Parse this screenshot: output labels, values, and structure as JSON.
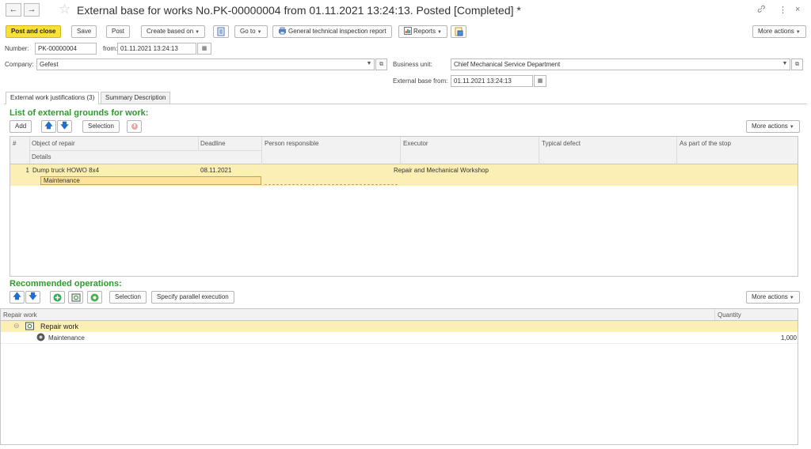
{
  "window": {
    "title": "External base for works No.PK-00000004 from 01.11.2021 13:24:13. Posted [Completed] *",
    "back": "←",
    "forward": "→",
    "star": "☆",
    "link_icon": "🔗",
    "menu_icon": "⋮",
    "close_icon": "×"
  },
  "toolbar": {
    "post_and_close": "Post and close",
    "save": "Save",
    "post": "Post",
    "create_based_on": "Create based on",
    "go_to": "Go to",
    "general_report": "General technical inspection report",
    "reports": "Reports",
    "more_actions": "More actions"
  },
  "form": {
    "number_label": "Number:",
    "number_value": "PK-00000004",
    "from_label": "from:",
    "from_value": "01.11.2021 13:24:13",
    "company_label": "Company:",
    "company_value": "Gefest",
    "business_unit_label": "Business unit:",
    "business_unit_value": "Chief Mechanical Service Department",
    "external_base_label": "External base from:",
    "external_base_value": "01.11.2021 13:24:13"
  },
  "tabs": [
    {
      "label": "External work justifications (3)"
    },
    {
      "label": "Summary Description"
    }
  ],
  "grounds": {
    "title": "List of external grounds for work:",
    "add": "Add",
    "selection": "Selection",
    "more_actions": "More actions",
    "columns": {
      "num": "#",
      "object": "Object of repair",
      "details": "Details",
      "deadline": "Deadline",
      "person": "Person responsible",
      "executor": "Executor",
      "defect": "Typical defect",
      "stop": "As part of the stop"
    },
    "rows": [
      {
        "num": "1",
        "object": "Dump truck HOWO 8x4",
        "details": "Maintenance",
        "deadline": "08.11.2021",
        "person": "",
        "executor": "Repair and Mechanical Workshop",
        "defect": "",
        "stop": ""
      }
    ]
  },
  "operations": {
    "title": "Recommended operations:",
    "selection": "Selection",
    "parallel": "Specify parallel execution",
    "more_actions": "More actions",
    "columns": {
      "work": "Repair work",
      "quantity": "Quantity"
    },
    "group": {
      "label": "Repair work",
      "toggle": "⊖"
    },
    "items": [
      {
        "label": "Maintenance",
        "quantity": "1,000"
      }
    ]
  }
}
